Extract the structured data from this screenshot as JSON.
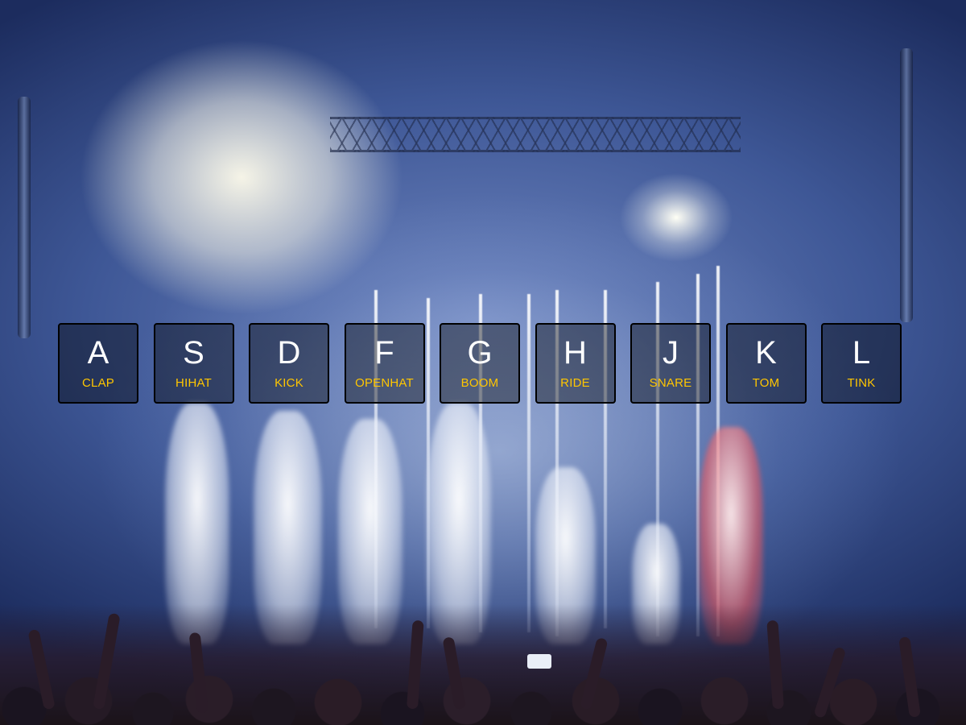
{
  "background": {
    "image_name": "concert-crowd-stage-background",
    "palette": {
      "stage_blue": "#3e5796",
      "haze_white": "#fffcea",
      "crowd_dark": "#1b1319"
    }
  },
  "colors": {
    "letter": "#ffffff",
    "sound_label": "#ffc600",
    "key_border": "#000000",
    "key_fill": "rgba(0,0,0,0.4)"
  },
  "keys": [
    {
      "letter": "A",
      "sound": "CLAP"
    },
    {
      "letter": "S",
      "sound": "HIHAT"
    },
    {
      "letter": "D",
      "sound": "KICK"
    },
    {
      "letter": "F",
      "sound": "OPENHAT"
    },
    {
      "letter": "G",
      "sound": "BOOM"
    },
    {
      "letter": "H",
      "sound": "RIDE"
    },
    {
      "letter": "J",
      "sound": "SNARE"
    },
    {
      "letter": "K",
      "sound": "TOM"
    },
    {
      "letter": "L",
      "sound": "TINK"
    }
  ]
}
